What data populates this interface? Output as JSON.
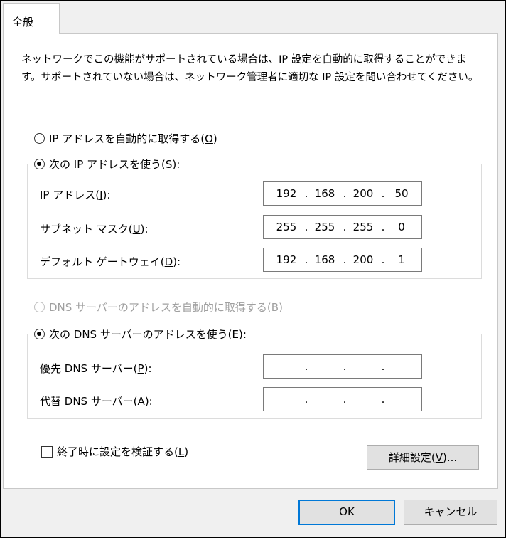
{
  "tab": {
    "label": "全般"
  },
  "description": "ネットワークでこの機能がサポートされている場合は、IP 設定を自動的に取得することができます。サポートされていない場合は、ネットワーク管理者に適切な IP 設定を問い合わせてください。",
  "ip": {
    "auto_label": "IP アドレスを自動的に取得する(",
    "auto_key": "O",
    "manual_label": "次の IP アドレスを使う(",
    "manual_key": "S",
    "fields": [
      {
        "label": "IP アドレス(",
        "key": "I",
        "octets": [
          "192",
          "168",
          "200",
          "50"
        ]
      },
      {
        "label": "サブネット マスク(",
        "key": "U",
        "octets": [
          "255",
          "255",
          "255",
          "0"
        ]
      },
      {
        "label": "デフォルト ゲートウェイ(",
        "key": "D",
        "octets": [
          "192",
          "168",
          "200",
          "1"
        ]
      }
    ]
  },
  "dns": {
    "auto_label": "DNS サーバーのアドレスを自動的に取得する(",
    "auto_key": "B",
    "manual_label": "次の DNS サーバーのアドレスを使う(",
    "manual_key": "E",
    "fields": [
      {
        "label": "優先 DNS サーバー(",
        "key": "P",
        "octets": [
          "",
          "",
          "",
          ""
        ]
      },
      {
        "label": "代替 DNS サーバー(",
        "key": "A",
        "octets": [
          "",
          "",
          "",
          ""
        ]
      }
    ]
  },
  "validate": {
    "label": "終了時に設定を検証する(",
    "key": "L"
  },
  "advanced_button": {
    "label": "詳細設定(",
    "key": "V",
    "suffix": ")..."
  },
  "ok_button": "OK",
  "cancel_button": "キャンセル",
  "close_paren": "):",
  "close_paren_plain": ")"
}
